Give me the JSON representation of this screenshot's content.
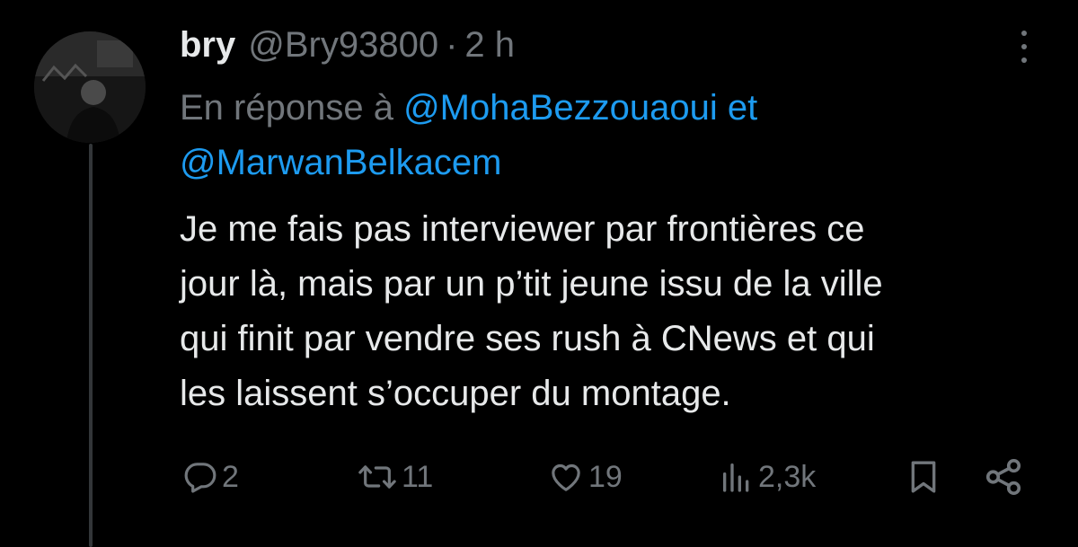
{
  "tweet": {
    "display_name": "bry",
    "handle": "@Bry93800",
    "separator": "·",
    "time": "2 h",
    "reply_prefix": "En réponse à",
    "mention_1": "@MohaBezzouaoui",
    "reply_joiner": "et",
    "mention_2": "@MarwanBelkacem",
    "text_lines": [
      "Je me fais pas interviewer par frontières ce",
      "jour là, mais par un p’tit jeune issu de la ville",
      "qui finit par vendre ses rush à CNews et qui",
      "les laissent s’occuper du montage."
    ]
  },
  "actions": {
    "replies": "2",
    "reposts": "11",
    "likes": "19",
    "views": "2,3k"
  },
  "icons": {
    "reply": "reply-icon",
    "repost": "repost-icon",
    "like": "heart-icon",
    "views": "views-icon",
    "bookmark": "bookmark-icon",
    "share": "share-icon",
    "more": "more-icon"
  },
  "colors": {
    "background": "#000000",
    "text": "#e7e9ea",
    "secondary": "#71767b",
    "link": "#1d9bf0"
  }
}
